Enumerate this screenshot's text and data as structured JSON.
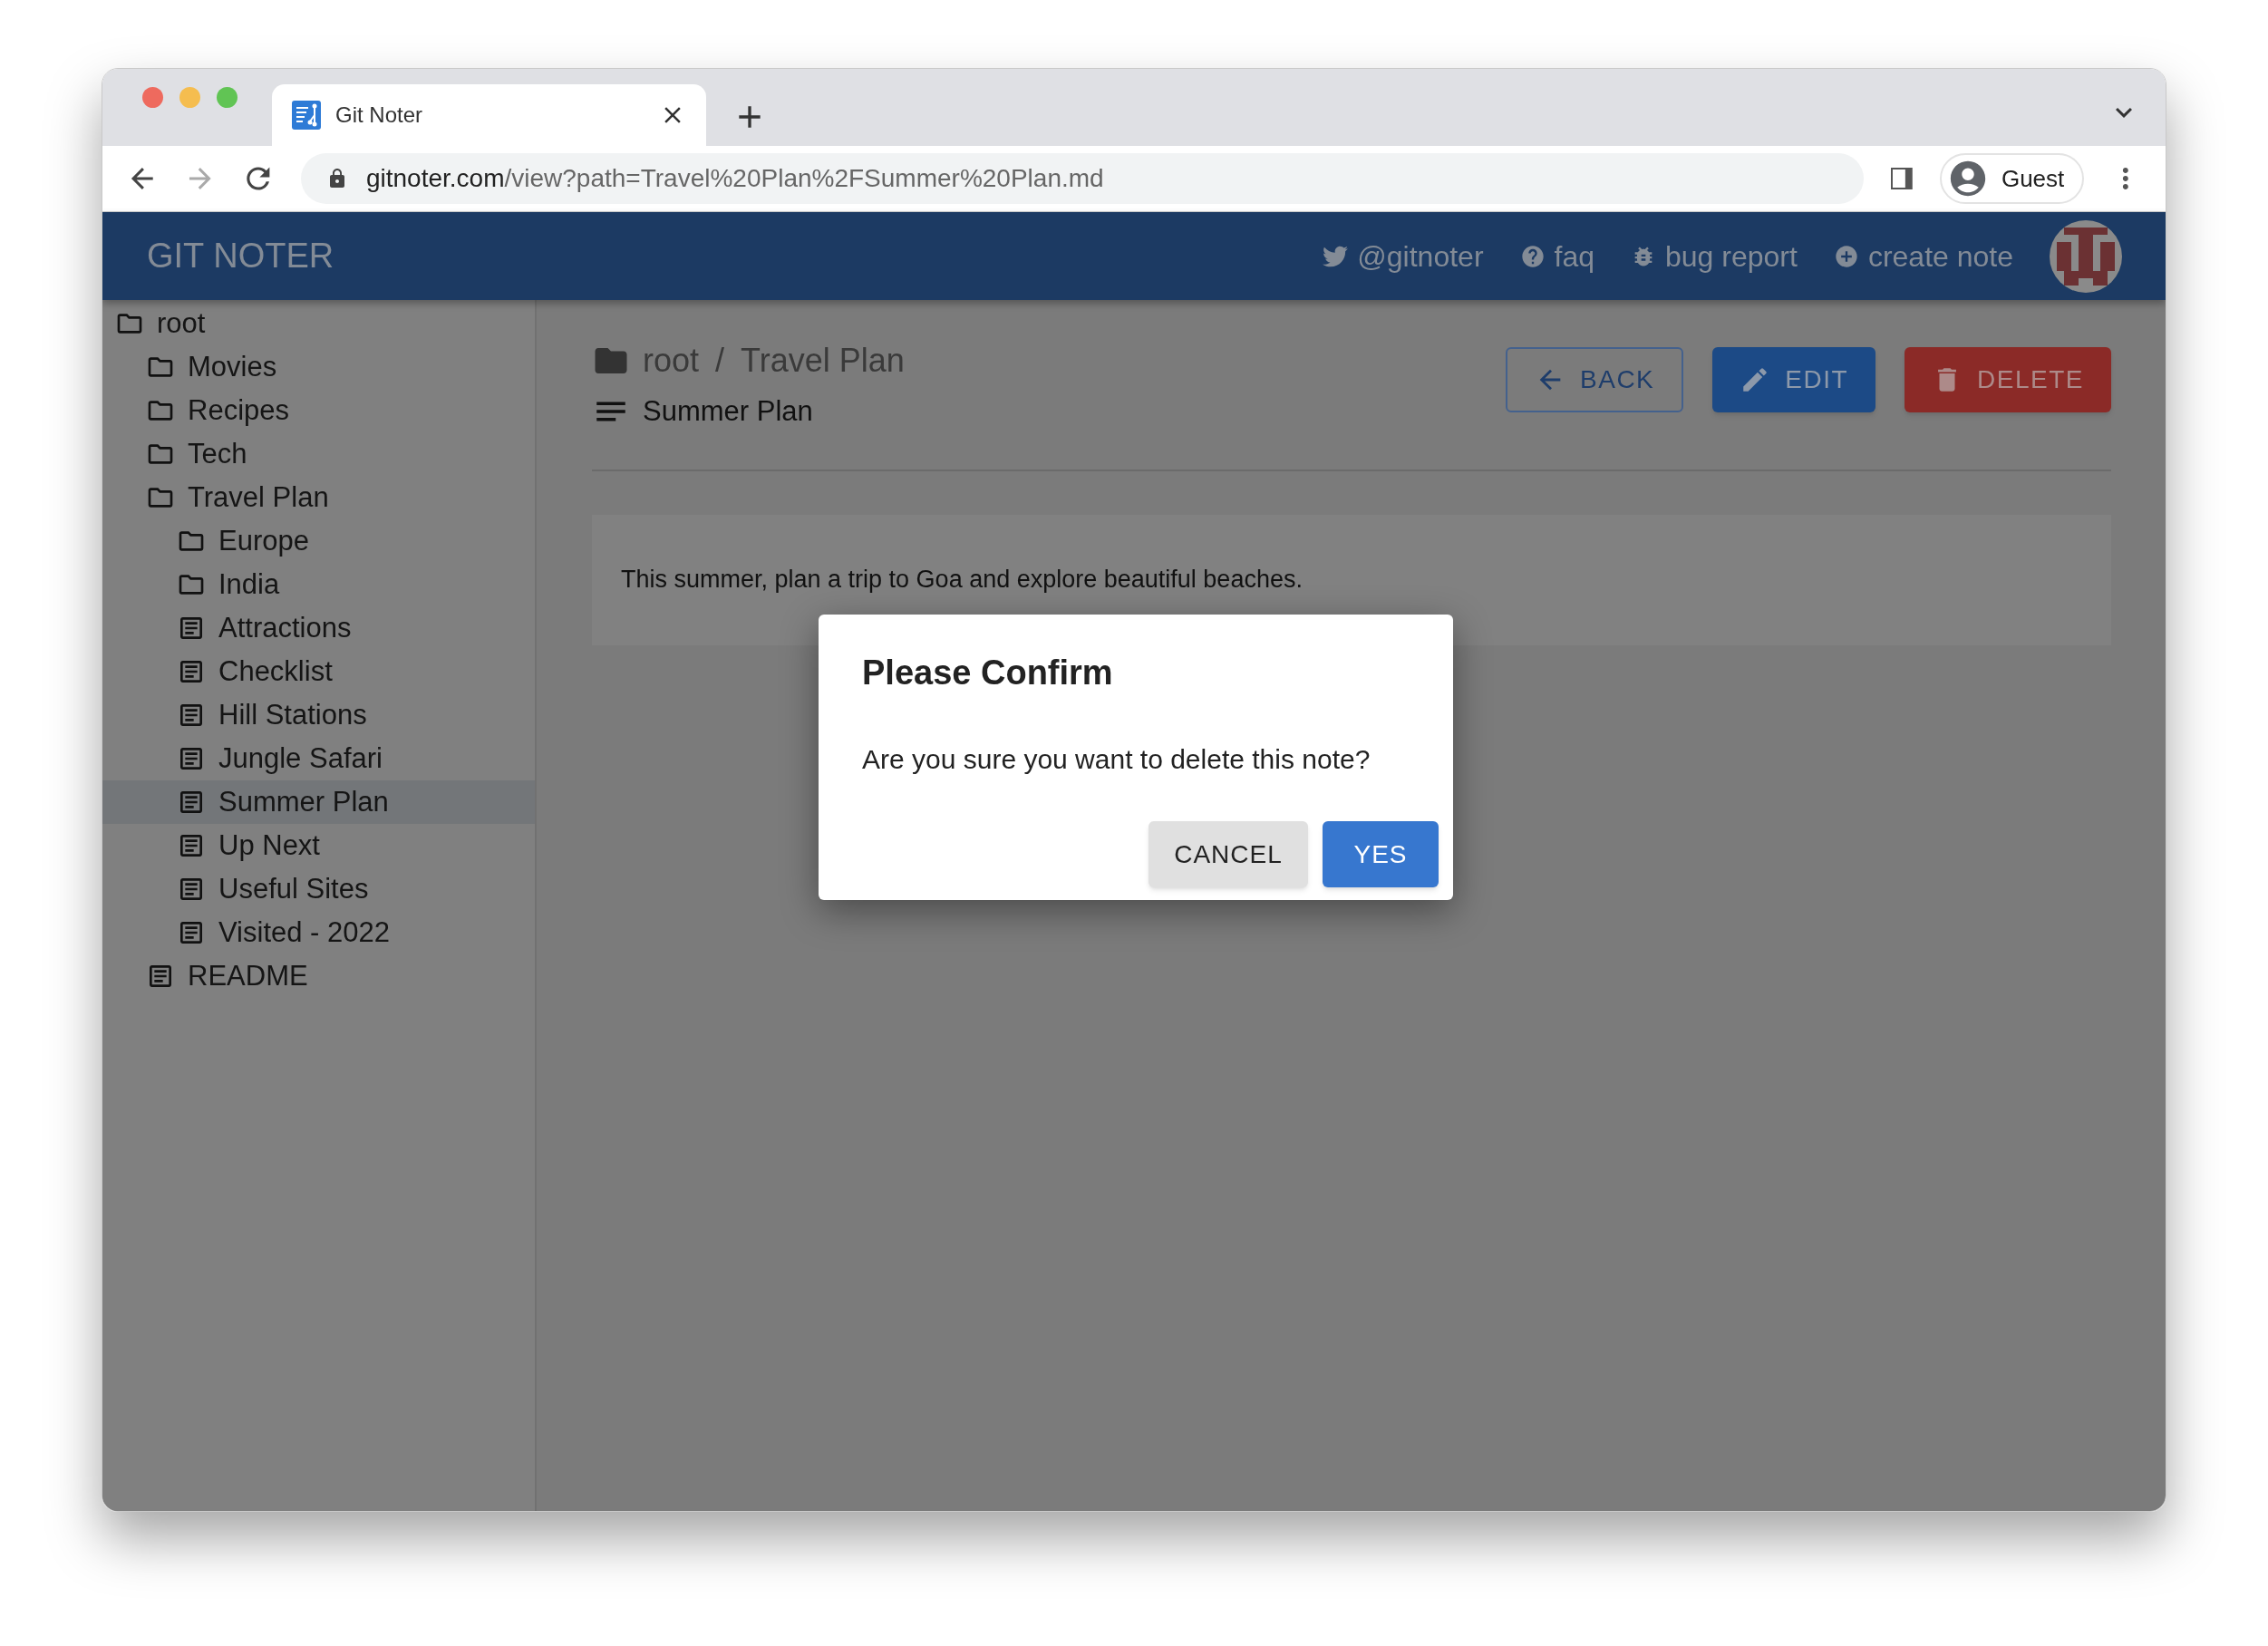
{
  "browser": {
    "tab": {
      "title": "Git Noter"
    },
    "url": {
      "host": "gitnoter.com",
      "path": "/view?path=Travel%20Plan%2FSummer%20Plan.md"
    },
    "profile": {
      "label": "Guest"
    }
  },
  "header": {
    "title": "GIT NOTER",
    "nav": [
      {
        "kind": "twitter",
        "label": "@gitnoter"
      },
      {
        "kind": "help",
        "label": "faq"
      },
      {
        "kind": "bug",
        "label": "bug report"
      },
      {
        "kind": "add",
        "label": "create note"
      }
    ]
  },
  "sidebar": {
    "tree": [
      {
        "kind": "folder",
        "label": "root",
        "selected": false,
        "children": [
          {
            "kind": "folder",
            "label": "Movies",
            "selected": false
          },
          {
            "kind": "folder",
            "label": "Recipes",
            "selected": false
          },
          {
            "kind": "folder",
            "label": "Tech",
            "selected": false
          },
          {
            "kind": "folder",
            "label": "Travel Plan",
            "selected": false,
            "children": [
              {
                "kind": "folder",
                "label": "Europe",
                "selected": false
              },
              {
                "kind": "folder",
                "label": "India",
                "selected": false
              },
              {
                "kind": "file",
                "label": "Attractions",
                "selected": false
              },
              {
                "kind": "file",
                "label": "Checklist",
                "selected": false
              },
              {
                "kind": "file",
                "label": "Hill Stations",
                "selected": false
              },
              {
                "kind": "file",
                "label": "Jungle Safari",
                "selected": false
              },
              {
                "kind": "file",
                "label": "Summer Plan",
                "selected": true
              },
              {
                "kind": "file",
                "label": "Up Next",
                "selected": false
              },
              {
                "kind": "file",
                "label": "Useful Sites",
                "selected": false
              },
              {
                "kind": "file",
                "label": "Visited - 2022",
                "selected": false
              }
            ]
          },
          {
            "kind": "file",
            "label": "README",
            "selected": false
          }
        ]
      }
    ]
  },
  "main": {
    "breadcrumb": [
      "root",
      "Travel Plan"
    ],
    "separator": "/",
    "note_title": "Summer Plan",
    "actions": [
      {
        "kind": "back",
        "label": "BACK"
      },
      {
        "kind": "edit",
        "label": "EDIT"
      },
      {
        "kind": "delete",
        "label": "DELETE"
      }
    ],
    "content": "This summer, plan a trip to Goa and explore beautiful beaches."
  },
  "dialog": {
    "title": "Please Confirm",
    "message": "Are you sure you want to delete this note?",
    "buttons": [
      {
        "kind": "cancel",
        "label": "CANCEL"
      },
      {
        "kind": "confirm",
        "label": "YES"
      }
    ]
  }
}
